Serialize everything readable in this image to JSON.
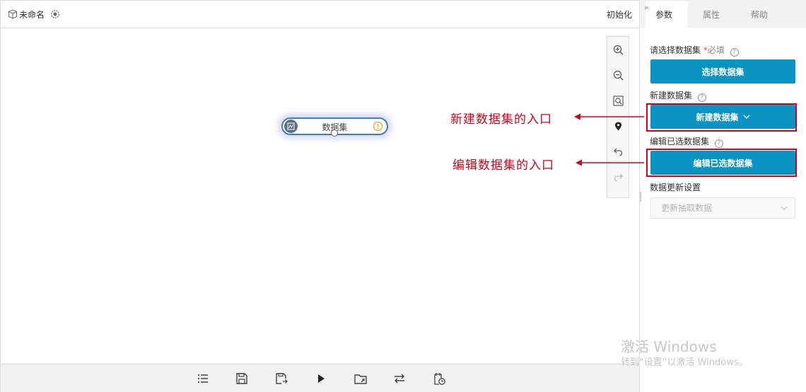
{
  "topbar": {
    "title": "未命名",
    "init_label": "初始化"
  },
  "canvas": {
    "node_label": "数据集",
    "tools": [
      "zoom-in",
      "zoom-out",
      "fit-view",
      "locate",
      "undo",
      "redo"
    ]
  },
  "bottom_toolbar": [
    "list",
    "save",
    "save-as",
    "run",
    "export",
    "swap",
    "schedule"
  ],
  "right_panel": {
    "collapse_symbol": "»",
    "tabs": [
      "参数",
      "属性",
      "帮助"
    ],
    "active_tab": "参数",
    "select_dataset": {
      "label": "请选择数据集",
      "required_mark": "*",
      "required_text": "必填",
      "button": "选择数据集"
    },
    "new_dataset": {
      "label": "新建数据集",
      "button": "新建数据集"
    },
    "edit_dataset": {
      "label": "编辑已选数据集",
      "button": "编辑已选数据集"
    },
    "update_settings": {
      "label": "数据更新设置",
      "placeholder": "更新抽取数据"
    },
    "help_glyph": "?"
  },
  "annotations": {
    "new_entry": "新建数据集的入口",
    "edit_entry": "编辑数据集的入口",
    "color": "#d0021b"
  },
  "watermark": {
    "line1": "激活 Windows",
    "line2": "转到“设置”以激活 Windows。"
  },
  "colors": {
    "primary": "#0b93c4",
    "node_border": "#3e7fb1",
    "annotation": "#d0021b"
  }
}
